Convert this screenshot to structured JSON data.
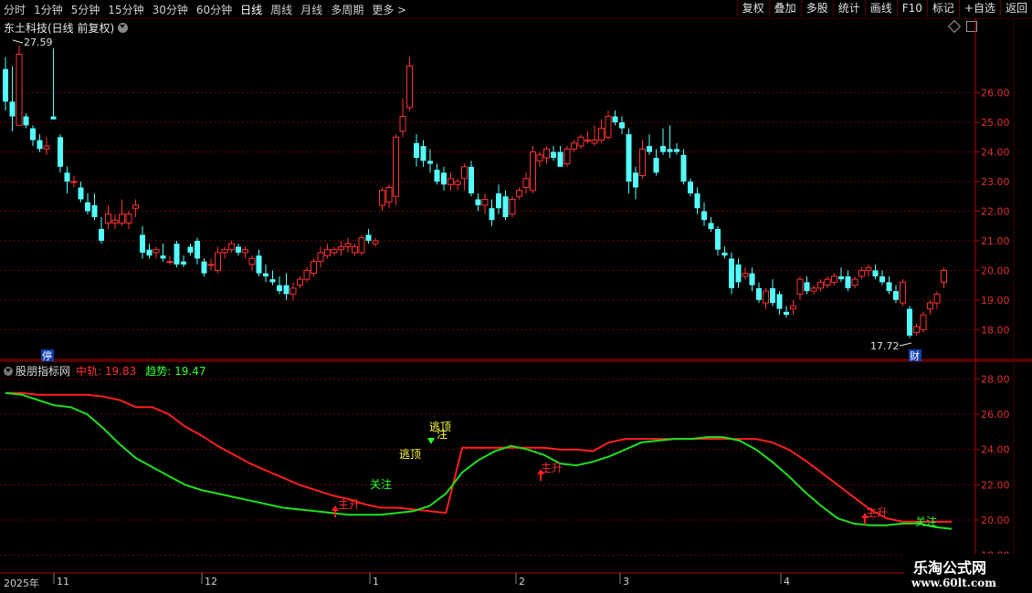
{
  "toolbar": {
    "periods": [
      "分时",
      "1分钟",
      "5分钟",
      "15分钟",
      "30分钟",
      "60分钟",
      "日线",
      "周线",
      "月线",
      "多周期",
      "更多 >"
    ],
    "active_period": "日线",
    "buttons": [
      "复权",
      "叠加",
      "多股",
      "统计",
      "画线",
      "F10",
      "标记",
      "+自选",
      "返回"
    ]
  },
  "main_chart": {
    "title": "东土科技(日线 前复权)",
    "price_axis": [
      "26.00",
      "25.00",
      "24.00",
      "23.00",
      "22.00",
      "21.00",
      "20.00",
      "19.00",
      "18.00"
    ],
    "high_label": "27.59",
    "low_label": "17.72",
    "event_markers": [
      {
        "text": "停"
      },
      {
        "text": "财"
      }
    ]
  },
  "indicator": {
    "name": "股朋指标网",
    "zg_label": "中轨",
    "zg_value": "19.83",
    "qs_label": "趋势",
    "qs_value": "19.47",
    "axis": [
      "28.00",
      "26.00",
      "24.00",
      "22.00",
      "20.00",
      "18.00"
    ],
    "signals": [
      {
        "text": "关注",
        "color": "#30ff30"
      },
      {
        "text": "主升",
        "color": "#ff3030"
      },
      {
        "text": "逃顶",
        "color": "#ffff40"
      },
      {
        "text": "逃顶",
        "color": "#ffff40"
      },
      {
        "text": "注",
        "color": "#ffff40"
      },
      {
        "text": "主升",
        "color": "#ff3030"
      },
      {
        "text": "主升",
        "color": "#ff3030"
      },
      {
        "text": "关注",
        "color": "#30ff30"
      }
    ]
  },
  "date_axis": {
    "year": "2025年",
    "months": [
      "11",
      "12",
      "1",
      "2",
      "3",
      "4"
    ]
  },
  "watermark": {
    "line1": "乐淘公式网",
    "line2": "www.60lt.com"
  },
  "chart_data": {
    "type": "candlestick",
    "ylim": [
      17.3,
      27.9
    ],
    "candles": [
      [
        26.8,
        27.2,
        25.4,
        25.7
      ],
      [
        25.7,
        26.9,
        24.7,
        25.2
      ],
      [
        24.9,
        27.59,
        24.9,
        27.3
      ],
      [
        25.2,
        25.3,
        24.8,
        24.9
      ],
      [
        24.8,
        24.9,
        24.2,
        24.4
      ],
      [
        24.4,
        24.6,
        24.0,
        24.1
      ],
      [
        24.1,
        24.5,
        23.9,
        24.2
      ],
      [
        25.2,
        27.5,
        25.1,
        25.1
      ],
      [
        24.5,
        24.6,
        23.3,
        23.5
      ],
      [
        23.3,
        23.5,
        22.6,
        23.0
      ],
      [
        23.0,
        23.2,
        22.8,
        23.0
      ],
      [
        22.8,
        23.0,
        22.3,
        22.4
      ],
      [
        22.3,
        22.6,
        21.9,
        22.0
      ],
      [
        22.2,
        22.6,
        21.7,
        21.8
      ],
      [
        21.4,
        21.8,
        20.9,
        21.0
      ],
      [
        21.6,
        22.2,
        21.4,
        21.9
      ],
      [
        21.6,
        21.9,
        21.4,
        21.7
      ],
      [
        21.6,
        22.4,
        21.5,
        21.9
      ],
      [
        21.6,
        22.0,
        21.4,
        21.9
      ],
      [
        22.1,
        22.4,
        21.8,
        22.2
      ],
      [
        21.2,
        21.5,
        20.4,
        20.6
      ],
      [
        20.7,
        20.9,
        20.4,
        20.5
      ],
      [
        20.6,
        20.8,
        20.4,
        20.7
      ],
      [
        20.5,
        20.9,
        20.3,
        20.4
      ],
      [
        20.3,
        20.5,
        20.2,
        20.3
      ],
      [
        20.9,
        21.0,
        20.1,
        20.2
      ],
      [
        20.3,
        20.5,
        20.1,
        20.2
      ],
      [
        20.8,
        20.9,
        20.5,
        20.6
      ],
      [
        21.0,
        21.1,
        20.2,
        20.4
      ],
      [
        20.3,
        20.4,
        19.8,
        19.9
      ],
      [
        20.2,
        20.4,
        20.0,
        20.2
      ],
      [
        20.0,
        20.8,
        19.9,
        20.6
      ],
      [
        20.6,
        20.8,
        20.4,
        20.7
      ],
      [
        20.7,
        21.0,
        20.6,
        20.9
      ],
      [
        20.8,
        20.9,
        20.5,
        20.6
      ],
      [
        20.6,
        20.8,
        20.4,
        20.7
      ],
      [
        20.2,
        20.5,
        20.0,
        20.4
      ],
      [
        20.5,
        20.7,
        19.8,
        19.9
      ],
      [
        19.9,
        20.2,
        19.6,
        19.8
      ],
      [
        19.7,
        20.0,
        19.5,
        19.6
      ],
      [
        19.5,
        19.8,
        19.2,
        19.3
      ],
      [
        19.5,
        19.9,
        19.0,
        19.2
      ],
      [
        19.2,
        19.6,
        19.0,
        19.4
      ],
      [
        19.5,
        19.8,
        19.4,
        19.7
      ],
      [
        19.7,
        20.1,
        19.6,
        20.0
      ],
      [
        19.9,
        20.4,
        19.8,
        20.3
      ],
      [
        20.3,
        20.8,
        20.1,
        20.6
      ],
      [
        20.5,
        20.9,
        20.4,
        20.7
      ],
      [
        20.6,
        20.8,
        20.5,
        20.7
      ],
      [
        20.7,
        21.0,
        20.5,
        20.8
      ],
      [
        20.8,
        21.1,
        20.6,
        20.9
      ],
      [
        20.6,
        20.9,
        20.5,
        20.8
      ],
      [
        20.6,
        21.2,
        20.5,
        21.1
      ],
      [
        21.2,
        21.4,
        20.9,
        21.0
      ],
      [
        20.9,
        21.1,
        20.8,
        21.0
      ],
      [
        22.2,
        22.8,
        22.0,
        22.7
      ],
      [
        22.3,
        22.9,
        22.1,
        22.8
      ],
      [
        22.5,
        24.6,
        22.2,
        24.5
      ],
      [
        24.7,
        25.8,
        24.5,
        25.2
      ],
      [
        25.5,
        27.2,
        25.4,
        26.9
      ],
      [
        24.3,
        24.6,
        23.5,
        23.8
      ],
      [
        24.2,
        24.4,
        23.5,
        23.7
      ],
      [
        23.7,
        24.1,
        23.3,
        23.6
      ],
      [
        23.4,
        23.6,
        22.9,
        23.0
      ],
      [
        23.3,
        23.5,
        22.7,
        22.9
      ],
      [
        22.9,
        23.3,
        22.7,
        23.1
      ],
      [
        22.9,
        23.1,
        22.7,
        23.0
      ],
      [
        23.1,
        23.6,
        22.7,
        23.5
      ],
      [
        23.5,
        23.7,
        22.5,
        22.6
      ],
      [
        22.4,
        22.6,
        22.0,
        22.2
      ],
      [
        22.2,
        22.6,
        21.9,
        22.4
      ],
      [
        22.1,
        22.4,
        21.5,
        21.7
      ],
      [
        22.6,
        22.9,
        21.9,
        22.1
      ],
      [
        22.5,
        22.7,
        21.7,
        21.8
      ],
      [
        21.9,
        22.5,
        21.8,
        22.4
      ],
      [
        22.5,
        22.8,
        22.4,
        22.7
      ],
      [
        22.8,
        23.3,
        22.6,
        23.1
      ],
      [
        22.7,
        24.2,
        22.6,
        24.0
      ],
      [
        23.7,
        24.0,
        23.5,
        23.9
      ],
      [
        23.8,
        24.2,
        23.6,
        24.1
      ],
      [
        24.0,
        24.2,
        23.7,
        23.8
      ],
      [
        24.0,
        24.2,
        23.7,
        23.5
      ],
      [
        23.6,
        24.2,
        23.5,
        24.1
      ],
      [
        24.1,
        24.4,
        24.0,
        24.3
      ],
      [
        24.2,
        24.6,
        24.1,
        24.5
      ],
      [
        24.4,
        24.7,
        24.3,
        24.4
      ],
      [
        24.3,
        24.9,
        24.2,
        24.4
      ],
      [
        24.4,
        25.1,
        24.3,
        24.8
      ],
      [
        24.5,
        25.4,
        24.4,
        25.2
      ],
      [
        25.2,
        25.4,
        24.9,
        25.0
      ],
      [
        25.0,
        25.2,
        24.6,
        24.8
      ],
      [
        24.6,
        24.8,
        22.6,
        23.0
      ],
      [
        23.3,
        23.5,
        22.4,
        22.8
      ],
      [
        23.2,
        24.4,
        23.1,
        24.1
      ],
      [
        24.2,
        24.6,
        23.9,
        24.0
      ],
      [
        23.8,
        24.1,
        23.2,
        23.3
      ],
      [
        24.2,
        24.8,
        23.9,
        24.0
      ],
      [
        24.1,
        24.9,
        23.8,
        24.0
      ],
      [
        24.1,
        24.3,
        23.9,
        24.0
      ],
      [
        23.9,
        24.1,
        22.9,
        23.0
      ],
      [
        23.0,
        23.1,
        22.5,
        22.6
      ],
      [
        22.6,
        22.8,
        21.9,
        22.1
      ],
      [
        22.0,
        22.3,
        21.5,
        21.7
      ],
      [
        21.6,
        21.8,
        21.3,
        21.4
      ],
      [
        21.4,
        21.5,
        20.5,
        20.7
      ],
      [
        20.6,
        20.8,
        20.4,
        20.5
      ],
      [
        20.4,
        20.6,
        19.2,
        19.4
      ],
      [
        20.2,
        20.4,
        19.4,
        19.6
      ],
      [
        19.8,
        20.1,
        19.7,
        19.9
      ],
      [
        19.9,
        20.1,
        19.3,
        19.5
      ],
      [
        19.4,
        19.6,
        18.9,
        19.0
      ],
      [
        18.9,
        19.4,
        18.7,
        19.3
      ],
      [
        19.4,
        19.7,
        18.8,
        18.9
      ],
      [
        19.2,
        19.3,
        18.5,
        18.7
      ],
      [
        18.6,
        18.8,
        18.4,
        18.5
      ],
      [
        18.7,
        19.0,
        18.5,
        18.8
      ],
      [
        19.2,
        19.8,
        19.0,
        19.7
      ],
      [
        19.6,
        19.8,
        19.2,
        19.3
      ],
      [
        19.3,
        19.5,
        19.2,
        19.4
      ],
      [
        19.4,
        19.7,
        19.3,
        19.6
      ],
      [
        19.5,
        19.8,
        19.4,
        19.7
      ],
      [
        19.6,
        19.9,
        19.5,
        19.8
      ],
      [
        19.8,
        20.1,
        19.6,
        19.7
      ],
      [
        19.8,
        20.0,
        19.3,
        19.4
      ],
      [
        19.5,
        19.8,
        19.4,
        19.7
      ],
      [
        19.8,
        20.1,
        19.7,
        20.0
      ],
      [
        20.0,
        20.2,
        19.8,
        20.1
      ],
      [
        20.0,
        20.2,
        19.7,
        19.8
      ],
      [
        19.8,
        20.0,
        19.5,
        19.6
      ],
      [
        19.6,
        19.8,
        19.2,
        19.3
      ],
      [
        19.3,
        19.5,
        18.9,
        19.0
      ],
      [
        18.9,
        19.7,
        18.8,
        19.6
      ],
      [
        18.7,
        18.8,
        17.72,
        17.8
      ],
      [
        17.9,
        18.2,
        17.8,
        18.1
      ],
      [
        18.0,
        18.6,
        17.9,
        18.5
      ],
      [
        18.7,
        19.0,
        18.5,
        18.9
      ],
      [
        18.9,
        19.3,
        18.7,
        19.2
      ],
      [
        19.6,
        20.1,
        19.4,
        20.0
      ]
    ],
    "zg_line_values": [
      27.2,
      27.2,
      27.1,
      27.1,
      27.1,
      27.1,
      27.0,
      26.8,
      26.4,
      26.4,
      26.0,
      25.3,
      24.8,
      24.2,
      23.7,
      23.2,
      22.8,
      22.4,
      22.0,
      21.7,
      21.4,
      21.2,
      20.9,
      20.7,
      20.7,
      20.6,
      20.5,
      20.4,
      24.1,
      24.1,
      24.1,
      24.1,
      24.1,
      24.1,
      24.0,
      24.0,
      23.9,
      24.4,
      24.6,
      24.6,
      24.6,
      24.6,
      24.6,
      24.6,
      24.6,
      24.6,
      24.6,
      24.4,
      24.0,
      23.4,
      22.7,
      22.0,
      21.3,
      20.6,
      20.1,
      19.9,
      19.9,
      19.9,
      19.9
    ],
    "qs_line_values": [
      27.2,
      27.1,
      26.8,
      26.5,
      26.4,
      26.0,
      25.2,
      24.3,
      23.5,
      23.0,
      22.5,
      22.0,
      21.7,
      21.5,
      21.3,
      21.1,
      20.9,
      20.7,
      20.6,
      20.5,
      20.4,
      20.3,
      20.3,
      20.3,
      20.4,
      20.5,
      20.8,
      21.5,
      22.7,
      23.4,
      23.9,
      24.2,
      24.0,
      23.7,
      23.2,
      23.1,
      23.3,
      23.6,
      24.0,
      24.4,
      24.5,
      24.6,
      24.6,
      24.7,
      24.7,
      24.5,
      24.0,
      23.3,
      22.5,
      21.6,
      20.8,
      20.1,
      19.8,
      19.7,
      19.7,
      19.8,
      19.8,
      19.6,
      19.5
    ],
    "ind_ylim": [
      17.0,
      29.0
    ]
  }
}
